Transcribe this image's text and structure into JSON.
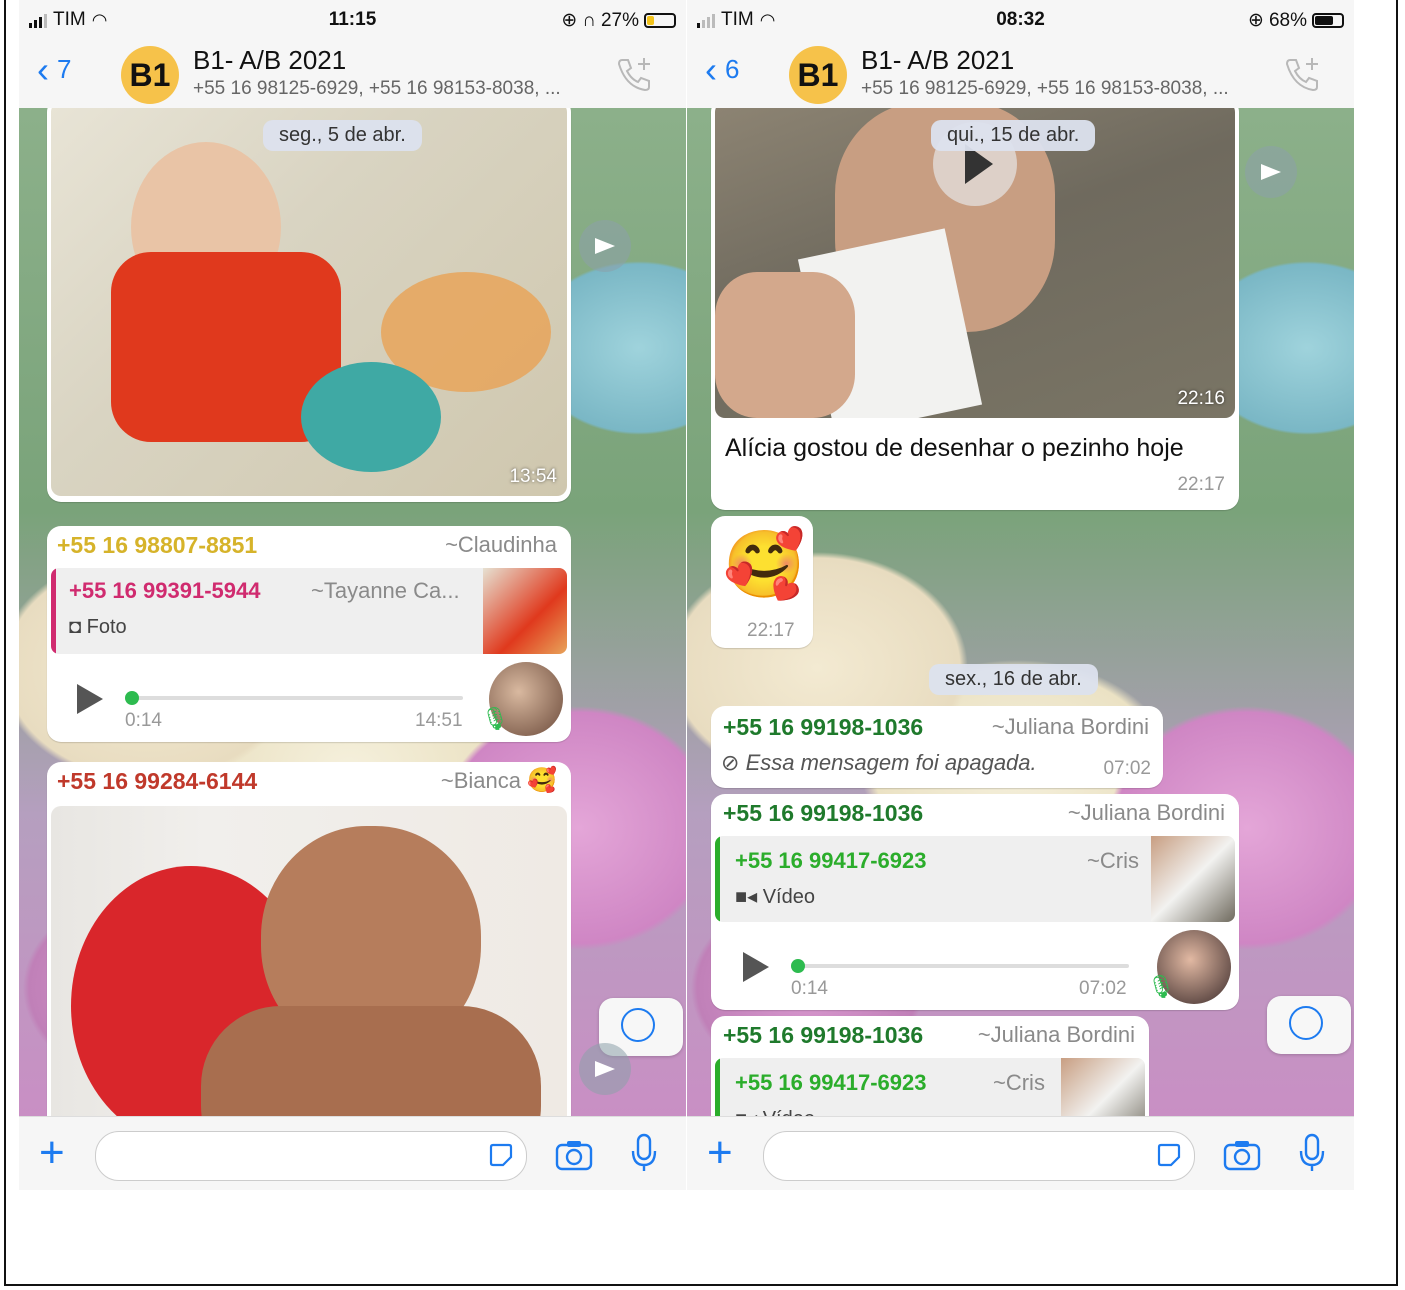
{
  "left": {
    "status": {
      "carrier": "TIM",
      "time": "11:15",
      "battery": "27%"
    },
    "header": {
      "back_count": "7",
      "avatar_text": "B1",
      "title": "B1- A/B 2021",
      "subtitle": "+55 16 98125-6929, +55 16 98153-8038, ..."
    },
    "date_chip": "seg., 5 de abr.",
    "photo_time": "13:54",
    "reply_msg": {
      "sender": "+55 16 98807-8851",
      "alias": "~Claudinha",
      "quote_sender": "+55 16 99391-5944",
      "quote_alias": "~Tayanne Ca...",
      "quote_type": "Foto",
      "voice_duration": "0:14",
      "time": "14:51"
    },
    "photo_msg": {
      "sender": "+55 16 99284-6144",
      "alias": "~Bianca"
    }
  },
  "right": {
    "status": {
      "carrier": "TIM",
      "time": "08:32",
      "battery": "68%"
    },
    "header": {
      "back_count": "6",
      "avatar_text": "B1",
      "title": "B1- A/B 2021",
      "subtitle": "+55 16 98125-6929, +55 16 98153-8038, ..."
    },
    "date_chip_1": "qui., 15 de abr.",
    "video_time": "22:16",
    "caption": "Alícia gostou de desenhar o pezinho hoje",
    "caption_time": "22:17",
    "emoji_time": "22:17",
    "date_chip_2": "sex., 16 de abr.",
    "deleted_msg": {
      "sender": "+55 16 99198-1036",
      "alias": "~Juliana Bordini",
      "text": "Essa mensagem foi apagada.",
      "time": "07:02"
    },
    "reply_msg": {
      "sender": "+55 16 99198-1036",
      "alias": "~Juliana Bordini",
      "quote_sender": "+55 16 99417-6923",
      "quote_alias": "~Cris",
      "quote_type": "Vídeo",
      "voice_duration": "0:14",
      "time": "07:02"
    },
    "reply_msg_2": {
      "sender": "+55 16 99198-1036",
      "alias": "~Juliana Bordini",
      "quote_sender": "+55 16 99417-6923",
      "quote_alias": "~Cris",
      "quote_type": "Vídeo"
    }
  },
  "colors": {
    "accent": "#1d7bf0",
    "claudinha": "#d6b32a",
    "tayanne": "#d02b6f",
    "bianca": "#c0392b",
    "juliana": "#1f7a2c",
    "cris": "#2bad2b"
  }
}
